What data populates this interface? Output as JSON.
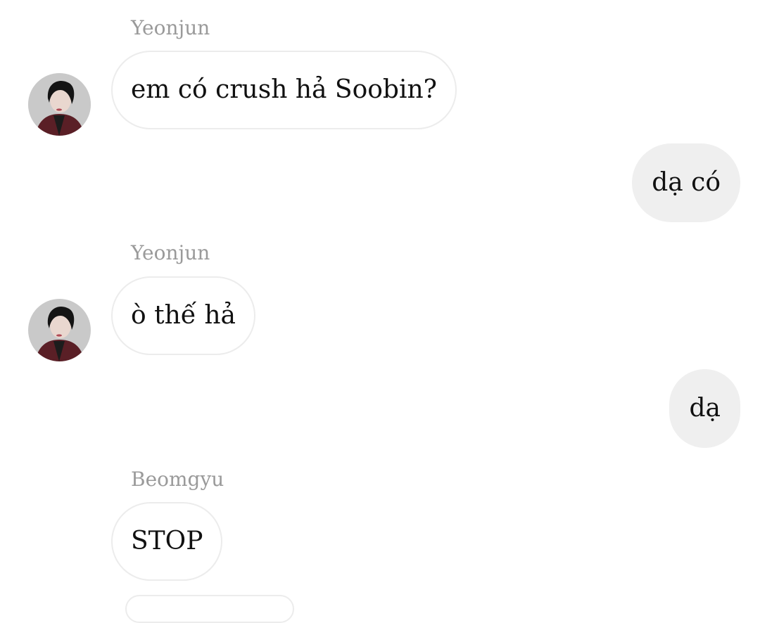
{
  "messages": [
    {
      "sender": "Yeonjun",
      "text": "em có crush hả Soobin?",
      "direction": "incoming"
    },
    {
      "text": "dạ có",
      "direction": "outgoing"
    },
    {
      "sender": "Yeonjun",
      "text": "ò thế hả",
      "direction": "incoming"
    },
    {
      "text": "dạ",
      "direction": "outgoing"
    },
    {
      "sender": "Beomgyu",
      "text": "STOP",
      "direction": "incoming"
    }
  ],
  "colors": {
    "incoming_bubble": "#ffffff",
    "incoming_border": "#ececec",
    "outgoing_bubble": "#efefef",
    "sender_name": "#9a9a9a",
    "text": "#111111"
  }
}
